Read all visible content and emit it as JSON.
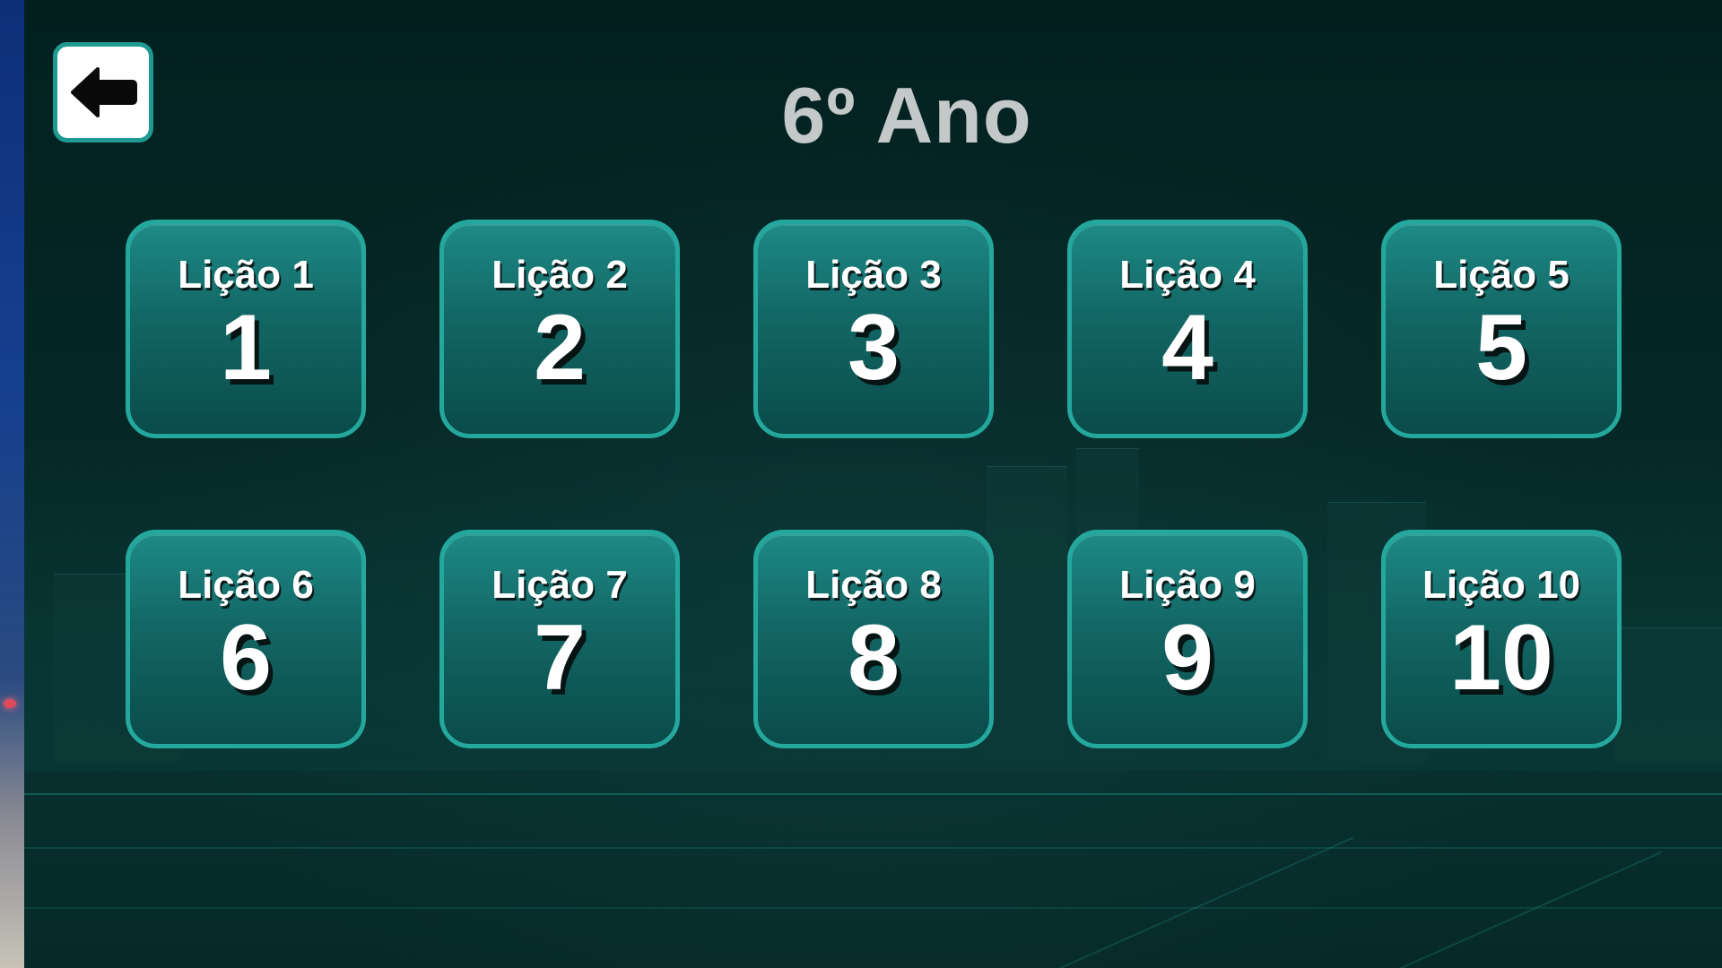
{
  "header": {
    "title": "6º Ano",
    "back_icon": "arrow-left-icon"
  },
  "lessons": [
    {
      "name": "Lição 1",
      "number": "1"
    },
    {
      "name": "Lição 2",
      "number": "2"
    },
    {
      "name": "Lição 3",
      "number": "3"
    },
    {
      "name": "Lição 4",
      "number": "4"
    },
    {
      "name": "Lição 5",
      "number": "5"
    },
    {
      "name": "Lição 6",
      "number": "6"
    },
    {
      "name": "Lição 7",
      "number": "7"
    },
    {
      "name": "Lição 8",
      "number": "8"
    },
    {
      "name": "Lição 9",
      "number": "9"
    },
    {
      "name": "Lição 10",
      "number": "10"
    }
  ],
  "colors": {
    "background": "#03201f",
    "tile_border": "#24a89e",
    "tile_top": "#1e8a86",
    "tile_bottom": "#0a4c4a",
    "title_text": "#c3c8c8"
  }
}
